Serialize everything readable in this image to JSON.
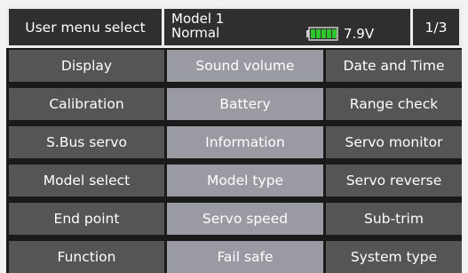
{
  "header": {
    "title": "User menu select",
    "model_name": "Model 1",
    "model_mode": "Normal",
    "battery_voltage": "7.9V",
    "battery_level": 1.0,
    "page": "1/3"
  },
  "menu": [
    [
      "Display",
      "Sound volume",
      "Date and Time"
    ],
    [
      "Calibration",
      "Battery",
      "Range check"
    ],
    [
      "S.Bus servo",
      "Information",
      "Servo monitor"
    ],
    [
      "Model select",
      "Model type",
      "Servo reverse"
    ],
    [
      "End point",
      "Servo speed",
      "Sub-trim"
    ],
    [
      "Function",
      "Fail safe",
      "System type"
    ]
  ],
  "colors": {
    "button_dark": "#555555",
    "button_light": "#9a9aa2",
    "header_bg": "#2f2f2f",
    "battery_green": "#2ec52e"
  }
}
